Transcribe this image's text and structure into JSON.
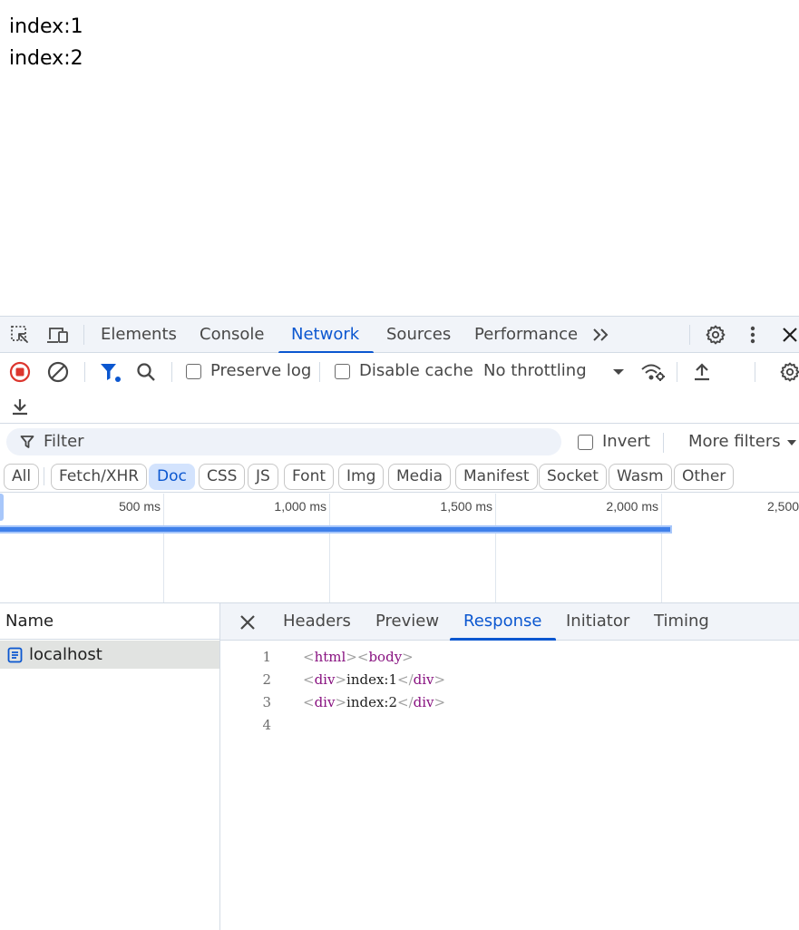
{
  "page": {
    "lines": [
      "index:1",
      "index:2"
    ]
  },
  "devtools": {
    "tabs": [
      "Elements",
      "Console",
      "Network",
      "Sources",
      "Performance"
    ],
    "active_tab": "Network",
    "toolbar": {
      "preserve_log": "Preserve log",
      "disable_cache": "Disable cache",
      "throttling": "No throttling"
    },
    "filter": {
      "placeholder": "Filter",
      "invert": "Invert",
      "more_filters": "More filters"
    },
    "type_filters": [
      "All",
      "Fetch/XHR",
      "Doc",
      "CSS",
      "JS",
      "Font",
      "Img",
      "Media",
      "Manifest",
      "Socket",
      "Wasm",
      "Other"
    ],
    "active_type_filter": "Doc",
    "timeline": {
      "ticks": [
        "500 ms",
        "1,000 ms",
        "1,500 ms",
        "2,000 ms",
        "2,500"
      ]
    },
    "requests": {
      "header": "Name",
      "items": [
        {
          "name": "localhost",
          "selected": true
        }
      ]
    },
    "detail": {
      "tabs": [
        "Headers",
        "Preview",
        "Response",
        "Initiator",
        "Timing"
      ],
      "active_tab": "Response",
      "response_lines": [
        {
          "num": "1",
          "text": "<html><body>"
        },
        {
          "num": "2",
          "text": "<div>index:1</div>"
        },
        {
          "num": "3",
          "text": "<div>index:2</div>"
        },
        {
          "num": "4",
          "text": ""
        }
      ]
    },
    "colors": {
      "accent": "#0b57d0",
      "record": "#dc362e",
      "toolbar_bg": "#f1f4f9",
      "selected_row": "#e1e3e1",
      "bar": "#3f80ea"
    }
  }
}
